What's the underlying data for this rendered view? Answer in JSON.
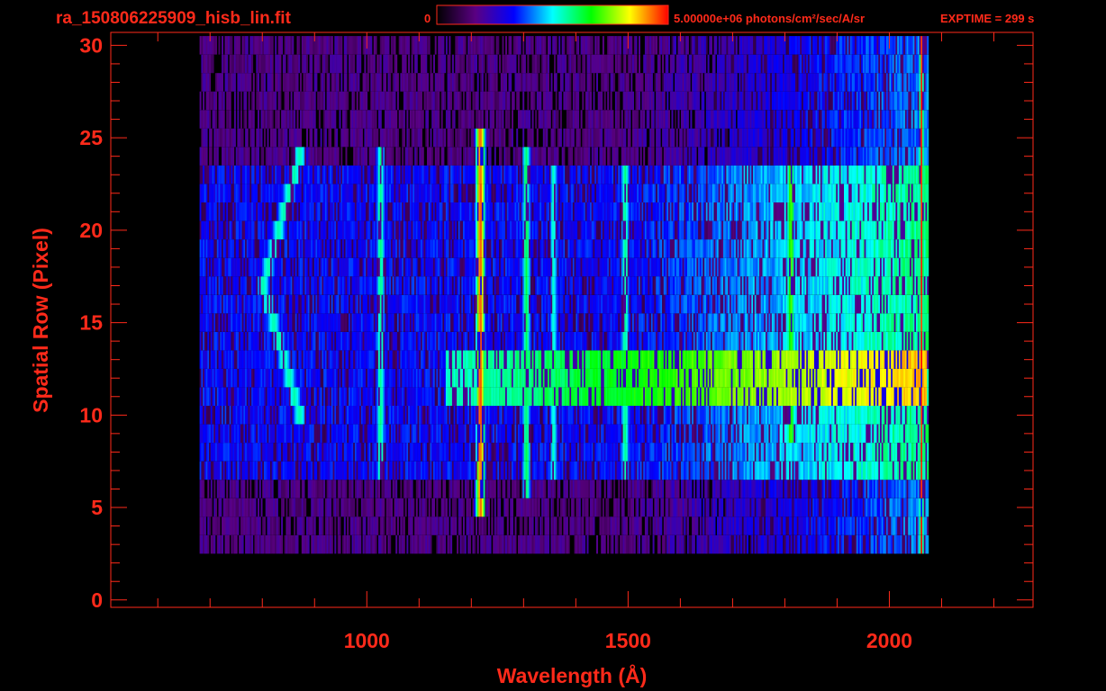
{
  "chart_data": {
    "type": "heatmap",
    "title": "ra_150806225909_hisb_lin.fit",
    "xlabel": "Wavelength (Å)",
    "ylabel": "Spatial Row (Pixel)",
    "xlim": [
      510,
      2275
    ],
    "ylim": [
      -0.4,
      30.7
    ],
    "x_ticks": [
      "1000",
      "1500",
      "2000"
    ],
    "x_tick_values": [
      1000,
      1500,
      2000
    ],
    "y_ticks": [
      "0",
      "5",
      "10",
      "15",
      "20",
      "25",
      "30"
    ],
    "y_tick_values": [
      0,
      5,
      10,
      15,
      20,
      25,
      30
    ],
    "colorbar": {
      "min_label": "0",
      "max_label": "5.00000e+06 photons/cm²/sec/A/sr",
      "min_value": 0,
      "max_value": 5000000,
      "colormap": [
        "#000000",
        "#5a0082",
        "#0000ff",
        "#00ffff",
        "#00ff00",
        "#ffff00",
        "#ff0000"
      ]
    },
    "annotation": "EXPTIME = 299 s",
    "grid": false,
    "data_extent": {
      "wavelength_range": [
        680,
        2075
      ],
      "row_range": [
        3,
        30
      ]
    },
    "emission_features": [
      {
        "wavelength": 1025,
        "rows": [
          7,
          24
        ],
        "level": 0.55
      },
      {
        "wavelength": 1216,
        "rows": [
          5,
          25
        ],
        "level": 0.92
      },
      {
        "wavelength": 1304,
        "rows": [
          6,
          24
        ],
        "level": 0.58
      },
      {
        "wavelength": 1356,
        "rows": [
          7,
          23
        ],
        "level": 0.5
      },
      {
        "wavelength": 1493,
        "rows": [
          7,
          23
        ],
        "level": 0.55
      },
      {
        "wavelength": 1810,
        "rows": [
          9,
          23
        ],
        "level": 0.68
      },
      {
        "wavelength": 2060,
        "rows": [
          3,
          30
        ],
        "level": 0.95
      }
    ],
    "continuum_band": {
      "rows": [
        11,
        13
      ],
      "wavelength_range": [
        1150,
        2070
      ],
      "level_start": 0.5,
      "level_end": 0.85
    },
    "arc_feature": {
      "rows": [
        10,
        24
      ],
      "wavelength_range": [
        800,
        870
      ],
      "level": 0.55
    }
  },
  "colors": {
    "text": "#ff2a1a",
    "frame": "#ff2a1a",
    "background": "#000000"
  }
}
